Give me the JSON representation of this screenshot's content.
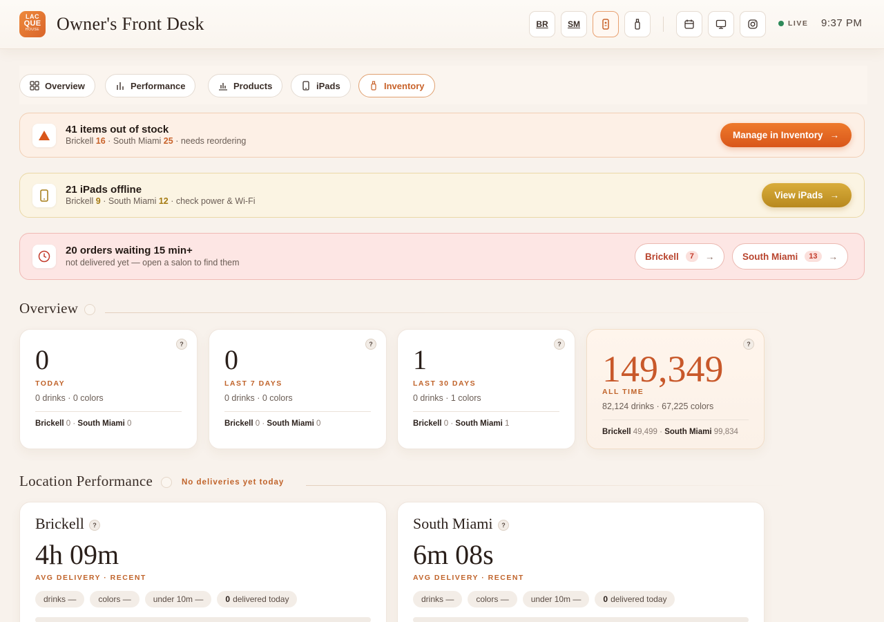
{
  "header": {
    "logo_lines": [
      "LAC",
      "QUE",
      "HOUSE"
    ],
    "title": "Owner's Front Desk",
    "btn_br": "BR",
    "btn_sm": "SM",
    "live": "LIVE",
    "time": "9:37 PM"
  },
  "tabs": [
    {
      "label": "Overview",
      "icon": "grid-icon"
    },
    {
      "label": "Performance",
      "icon": "bar-chart-icon"
    },
    {
      "label": "Products",
      "icon": "products-chart-icon"
    },
    {
      "label": "iPads",
      "icon": "tablet-icon"
    },
    {
      "label": "Inventory",
      "icon": "bottle-icon"
    }
  ],
  "alerts": {
    "stock": {
      "title": "41 items out of stock",
      "brickell_label": "Brickell",
      "brickell_count": "16",
      "sm_label": "South Miami",
      "sm_count": "25",
      "suffix": "needs reordering",
      "sep": "·",
      "cta": "Manage in Inventory",
      "arrow": "→"
    },
    "ipads": {
      "title": "21 iPads offline",
      "brickell_label": "Brickell",
      "brickell_count": "9",
      "sm_label": "South Miami",
      "sm_count": "12",
      "suffix": "check power & Wi-Fi",
      "sep": "·",
      "cta": "View iPads",
      "arrow": "→"
    },
    "orders": {
      "title": "20 orders waiting 15 min+",
      "sub": "not delivered yet — open a salon to find them",
      "brickell_label": "Brickell",
      "brickell_count": "7",
      "sm_label": "South Miami",
      "sm_count": "13",
      "arrow": "→"
    }
  },
  "overview": {
    "title": "Overview",
    "cards": [
      {
        "value": "0",
        "label": "TODAY",
        "sub": "0 drinks · 0 colors",
        "b_label": "Brickell",
        "b_val": "0",
        "sm_label": "South Miami",
        "sm_val": "0"
      },
      {
        "value": "0",
        "label": "LAST 7 DAYS",
        "sub": "0 drinks · 0 colors",
        "b_label": "Brickell",
        "b_val": "0",
        "sm_label": "South Miami",
        "sm_val": "0"
      },
      {
        "value": "1",
        "label": "LAST 30 DAYS",
        "sub": "0 drinks · 1 colors",
        "b_label": "Brickell",
        "b_val": "0",
        "sm_label": "South Miami",
        "sm_val": "1"
      },
      {
        "value": "149,349",
        "label": "ALL TIME",
        "sub": "82,124 drinks · 67,225 colors",
        "b_label": "Brickell",
        "b_val": "49,499",
        "sm_label": "South Miami",
        "sm_val": "99,834"
      }
    ],
    "help": "?"
  },
  "location_performance": {
    "title": "Location Performance",
    "status": "No deliveries yet today",
    "cards": [
      {
        "name": "Brickell",
        "time": "4h 09m",
        "label": "AVG DELIVERY · RECENT",
        "chips": [
          "drinks —",
          "colors —",
          "under 10m —"
        ],
        "delivered_count": "0",
        "delivered_label": "delivered today"
      },
      {
        "name": "South Miami",
        "time": "6m 08s",
        "label": "AVG DELIVERY · RECENT",
        "chips": [
          "drinks —",
          "colors —",
          "under 10m —"
        ],
        "delivered_count": "0",
        "delivered_label": "delivered today"
      }
    ]
  },
  "colors": {
    "accent": "#c8622a",
    "cta_orange": "#e46a22",
    "cta_gold": "#c99b2e",
    "live_dot": "#2e8a5a"
  }
}
